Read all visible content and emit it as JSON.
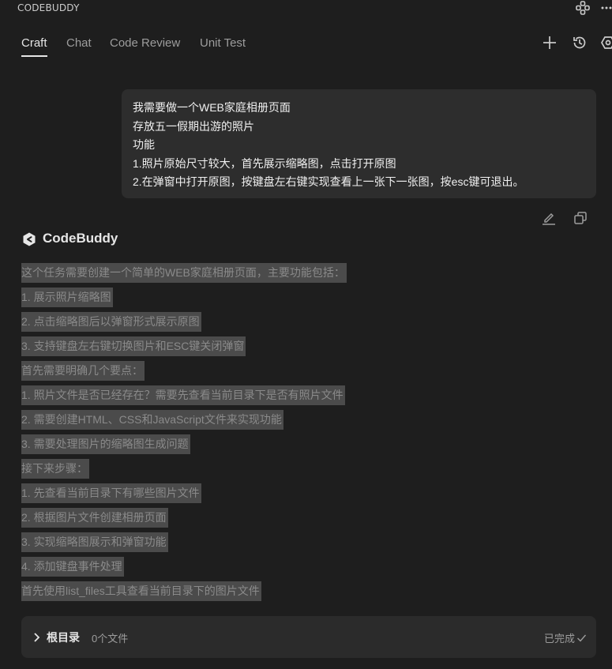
{
  "app": {
    "title": "CODEBUDDY"
  },
  "tabs": [
    {
      "label": "Craft",
      "active": true
    },
    {
      "label": "Chat",
      "active": false
    },
    {
      "label": "Code Review",
      "active": false
    },
    {
      "label": "Unit Test",
      "active": false
    }
  ],
  "icons": {
    "topbar": [
      "move-icon",
      "more-icon"
    ],
    "toolbar": [
      "add-icon",
      "history-icon",
      "settings-icon"
    ],
    "message_actions": [
      "edit-icon",
      "copy-icon"
    ]
  },
  "user_message": {
    "lines": [
      "我需要做一个WEB家庭相册页面",
      "存放五一假期出游的照片",
      "功能",
      "1.照片原始尺寸较大，首先展示缩略图，点击打开原图",
      "2.在弹窗中打开原图，按键盘左右键实现查看上一张下一张图，按esc键可退出。"
    ]
  },
  "assistant": {
    "name": "CodeBuddy",
    "lines": [
      "这个任务需要创建一个简单的WEB家庭相册页面，主要功能包括：",
      "1. 展示照片缩略图",
      "2. 点击缩略图后以弹窗形式展示原图",
      "3. 支持键盘左右键切换图片和ESC键关闭弹窗",
      "首先需要明确几个要点：",
      "1. 照片文件是否已经存在？需要先查看当前目录下是否有照片文件",
      "2. 需要创建HTML、CSS和JavaScript文件来实现功能",
      "3. 需要处理图片的缩略图生成问题",
      "接下来步骤：",
      "1. 先查看当前目录下有哪些图片文件",
      "2. 根据图片文件创建相册页面",
      "3. 实现缩略图展示和弹窗功能",
      "4. 添加键盘事件处理",
      "首先使用list_files工具查看当前目录下的图片文件"
    ]
  },
  "file_panel": {
    "title": "根目录",
    "count": "0个文件",
    "status": "已完成"
  },
  "colors": {
    "background": "#1e1e1e",
    "bubble": "#2d2d2d",
    "selection": "#4b4b4b",
    "panel": "#2b2b2b"
  }
}
